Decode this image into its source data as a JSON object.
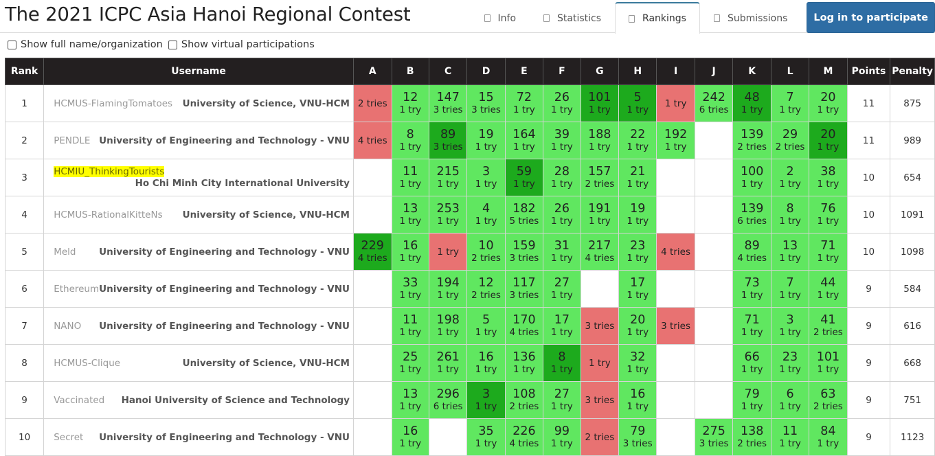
{
  "header": {
    "title": "The 2021 ICPC Asia Hanoi Regional Contest",
    "tabs": [
      "Info",
      "Statistics",
      "Rankings",
      "Submissions"
    ],
    "active_tab": "Rankings",
    "login_label": "Log in to participate"
  },
  "options": {
    "show_full_name": "Show full name/organization",
    "show_virtual": "Show virtual participations"
  },
  "table": {
    "headers": {
      "rank": "Rank",
      "username": "Username",
      "points": "Points",
      "penalty": "Penalty"
    },
    "problems": [
      "A",
      "B",
      "C",
      "D",
      "E",
      "F",
      "G",
      "H",
      "I",
      "J",
      "K",
      "L",
      "M"
    ],
    "colors": {
      "accepted": "#60e760",
      "first_solve": "#1daa1d",
      "failed": "#e87272",
      "header_bg": "#231f20"
    },
    "rows": [
      {
        "rank": "1",
        "username": "HCMUS-FlamingTomatoes",
        "org": "University of Science, VNU-HCM",
        "highlight": false,
        "points": "11",
        "penalty": "875",
        "cells": [
          [
            "w",
            "",
            "2 tries"
          ],
          [
            "a",
            "12",
            "1 try"
          ],
          [
            "a",
            "147",
            "3 tries"
          ],
          [
            "a",
            "15",
            "3 tries"
          ],
          [
            "a",
            "72",
            "1 try"
          ],
          [
            "a",
            "26",
            "1 try"
          ],
          [
            "f",
            "101",
            "1 try"
          ],
          [
            "f",
            "5",
            "1 try"
          ],
          [
            "w",
            "",
            "1 try"
          ],
          [
            "a",
            "242",
            "6 tries"
          ],
          [
            "f",
            "48",
            "1 try"
          ],
          [
            "a",
            "7",
            "1 try"
          ],
          [
            "a",
            "20",
            "1 try"
          ]
        ]
      },
      {
        "rank": "2",
        "username": "PENDLE",
        "org": "University of Engineering and Technology - VNU",
        "highlight": false,
        "points": "11",
        "penalty": "989",
        "cells": [
          [
            "w",
            "",
            "4 tries"
          ],
          [
            "a",
            "8",
            "1 try"
          ],
          [
            "f",
            "89",
            "3 tries"
          ],
          [
            "a",
            "19",
            "1 try"
          ],
          [
            "a",
            "164",
            "1 try"
          ],
          [
            "a",
            "39",
            "1 try"
          ],
          [
            "a",
            "188",
            "1 try"
          ],
          [
            "a",
            "22",
            "1 try"
          ],
          [
            "a",
            "192",
            "1 try"
          ],
          [
            "e",
            "",
            ""
          ],
          [
            "a",
            "139",
            "2 tries"
          ],
          [
            "a",
            "29",
            "2 tries"
          ],
          [
            "f",
            "20",
            "1 try"
          ]
        ]
      },
      {
        "rank": "3",
        "username": "HCMIU_ThinkingTourists",
        "org": "Ho Chi Minh City International University",
        "highlight": true,
        "points": "10",
        "penalty": "654",
        "cells": [
          [
            "e",
            "",
            ""
          ],
          [
            "a",
            "11",
            "1 try"
          ],
          [
            "a",
            "215",
            "1 try"
          ],
          [
            "a",
            "3",
            "1 try"
          ],
          [
            "f",
            "59",
            "1 try"
          ],
          [
            "a",
            "28",
            "1 try"
          ],
          [
            "a",
            "157",
            "2 tries"
          ],
          [
            "a",
            "21",
            "1 try"
          ],
          [
            "e",
            "",
            ""
          ],
          [
            "e",
            "",
            ""
          ],
          [
            "a",
            "100",
            "1 try"
          ],
          [
            "a",
            "2",
            "1 try"
          ],
          [
            "a",
            "38",
            "1 try"
          ]
        ]
      },
      {
        "rank": "4",
        "username": "HCMUS-RationalKitteNs",
        "org": "University of Science, VNU-HCM",
        "highlight": false,
        "points": "10",
        "penalty": "1091",
        "cells": [
          [
            "e",
            "",
            ""
          ],
          [
            "a",
            "13",
            "1 try"
          ],
          [
            "a",
            "253",
            "1 try"
          ],
          [
            "a",
            "4",
            "1 try"
          ],
          [
            "a",
            "182",
            "5 tries"
          ],
          [
            "a",
            "26",
            "1 try"
          ],
          [
            "a",
            "191",
            "1 try"
          ],
          [
            "a",
            "19",
            "1 try"
          ],
          [
            "e",
            "",
            ""
          ],
          [
            "e",
            "",
            ""
          ],
          [
            "a",
            "139",
            "6 tries"
          ],
          [
            "a",
            "8",
            "1 try"
          ],
          [
            "a",
            "76",
            "1 try"
          ]
        ]
      },
      {
        "rank": "5",
        "username": "Meld",
        "org": "University of Engineering and Technology - VNU",
        "highlight": false,
        "points": "10",
        "penalty": "1098",
        "cells": [
          [
            "f",
            "229",
            "4 tries"
          ],
          [
            "a",
            "16",
            "1 try"
          ],
          [
            "w",
            "",
            "1 try"
          ],
          [
            "a",
            "10",
            "2 tries"
          ],
          [
            "a",
            "159",
            "3 tries"
          ],
          [
            "a",
            "31",
            "1 try"
          ],
          [
            "a",
            "217",
            "4 tries"
          ],
          [
            "a",
            "23",
            "1 try"
          ],
          [
            "w",
            "",
            "4 tries"
          ],
          [
            "e",
            "",
            ""
          ],
          [
            "a",
            "89",
            "4 tries"
          ],
          [
            "a",
            "13",
            "1 try"
          ],
          [
            "a",
            "71",
            "1 try"
          ]
        ]
      },
      {
        "rank": "6",
        "username": "Ethereum",
        "org": "University of Engineering and Technology - VNU",
        "highlight": false,
        "points": "9",
        "penalty": "584",
        "cells": [
          [
            "e",
            "",
            ""
          ],
          [
            "a",
            "33",
            "1 try"
          ],
          [
            "a",
            "194",
            "1 try"
          ],
          [
            "a",
            "12",
            "2 tries"
          ],
          [
            "a",
            "117",
            "3 tries"
          ],
          [
            "a",
            "27",
            "1 try"
          ],
          [
            "e",
            "",
            ""
          ],
          [
            "a",
            "17",
            "1 try"
          ],
          [
            "e",
            "",
            ""
          ],
          [
            "e",
            "",
            ""
          ],
          [
            "a",
            "73",
            "1 try"
          ],
          [
            "a",
            "7",
            "1 try"
          ],
          [
            "a",
            "44",
            "1 try"
          ]
        ]
      },
      {
        "rank": "7",
        "username": "NANO",
        "org": "University of Engineering and Technology - VNU",
        "highlight": false,
        "points": "9",
        "penalty": "616",
        "cells": [
          [
            "e",
            "",
            ""
          ],
          [
            "a",
            "11",
            "1 try"
          ],
          [
            "a",
            "198",
            "1 try"
          ],
          [
            "a",
            "5",
            "1 try"
          ],
          [
            "a",
            "170",
            "4 tries"
          ],
          [
            "a",
            "17",
            "1 try"
          ],
          [
            "w",
            "",
            "3 tries"
          ],
          [
            "a",
            "20",
            "1 try"
          ],
          [
            "w",
            "",
            "3 tries"
          ],
          [
            "e",
            "",
            ""
          ],
          [
            "a",
            "71",
            "1 try"
          ],
          [
            "a",
            "3",
            "1 try"
          ],
          [
            "a",
            "41",
            "2 tries"
          ]
        ]
      },
      {
        "rank": "8",
        "username": "HCMUS-Clique",
        "org": "University of Science, VNU-HCM",
        "highlight": false,
        "points": "9",
        "penalty": "668",
        "cells": [
          [
            "e",
            "",
            ""
          ],
          [
            "a",
            "25",
            "1 try"
          ],
          [
            "a",
            "261",
            "1 try"
          ],
          [
            "a",
            "16",
            "1 try"
          ],
          [
            "a",
            "136",
            "1 try"
          ],
          [
            "f",
            "8",
            "1 try"
          ],
          [
            "w",
            "",
            "1 try"
          ],
          [
            "a",
            "32",
            "1 try"
          ],
          [
            "e",
            "",
            ""
          ],
          [
            "e",
            "",
            ""
          ],
          [
            "a",
            "66",
            "1 try"
          ],
          [
            "a",
            "23",
            "1 try"
          ],
          [
            "a",
            "101",
            "1 try"
          ]
        ]
      },
      {
        "rank": "9",
        "username": "Vaccinated",
        "org": "Hanoi University of Science and Technology",
        "highlight": false,
        "points": "9",
        "penalty": "751",
        "cells": [
          [
            "e",
            "",
            ""
          ],
          [
            "a",
            "13",
            "1 try"
          ],
          [
            "a",
            "296",
            "6 tries"
          ],
          [
            "f",
            "3",
            "1 try"
          ],
          [
            "a",
            "108",
            "2 tries"
          ],
          [
            "a",
            "27",
            "1 try"
          ],
          [
            "w",
            "",
            "3 tries"
          ],
          [
            "a",
            "16",
            "1 try"
          ],
          [
            "e",
            "",
            ""
          ],
          [
            "e",
            "",
            ""
          ],
          [
            "a",
            "79",
            "1 try"
          ],
          [
            "a",
            "6",
            "1 try"
          ],
          [
            "a",
            "63",
            "2 tries"
          ]
        ]
      },
      {
        "rank": "10",
        "username": "Secret",
        "org": "University of Engineering and Technology - VNU",
        "highlight": false,
        "points": "9",
        "penalty": "1123",
        "cells": [
          [
            "e",
            "",
            ""
          ],
          [
            "a",
            "16",
            "1 try"
          ],
          [
            "e",
            "",
            ""
          ],
          [
            "a",
            "35",
            "1 try"
          ],
          [
            "a",
            "226",
            "4 tries"
          ],
          [
            "a",
            "99",
            "1 try"
          ],
          [
            "w",
            "",
            "2 tries"
          ],
          [
            "a",
            "79",
            "3 tries"
          ],
          [
            "e",
            "",
            ""
          ],
          [
            "a",
            "275",
            "3 tries"
          ],
          [
            "a",
            "138",
            "2 tries"
          ],
          [
            "a",
            "11",
            "1 try"
          ],
          [
            "a",
            "84",
            "1 try"
          ]
        ]
      }
    ]
  }
}
